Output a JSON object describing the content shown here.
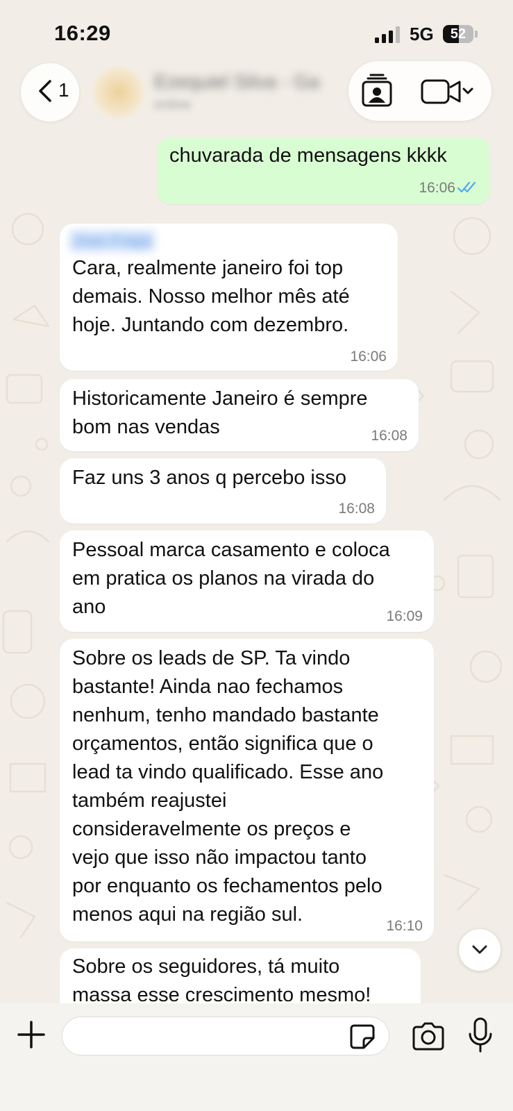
{
  "status_bar": {
    "time": "16:29",
    "network": "5G",
    "battery_percent": "52",
    "battery_level": 0.52
  },
  "header": {
    "back_count": "1",
    "contact_name": "Ezequiel Silva - Ga",
    "contact_subtitle": "online",
    "icons": [
      "chevron-left-icon",
      "contact-card-icon",
      "video-camera-icon",
      "chevron-down-icon"
    ]
  },
  "messages": [
    {
      "direction": "out",
      "text": [
        "chuvarada de mensagens kkkk"
      ],
      "time": "16:06",
      "status": "read"
    },
    {
      "direction": "in",
      "sender": "Joao Fraga",
      "text": [
        "Cara, realmente janeiro foi top",
        "demais. Nosso melhor mês até",
        "hoje. Juntando com dezembro."
      ],
      "time": "16:06"
    },
    {
      "direction": "in",
      "text": [
        "Historicamente Janeiro é sempre",
        "bom nas vendas"
      ],
      "time": "16:08"
    },
    {
      "direction": "in",
      "text": [
        "Faz uns 3 anos q percebo isso"
      ],
      "time": "16:08"
    },
    {
      "direction": "in",
      "text": [
        "Pessoal marca casamento e coloca",
        "em pratica os planos na virada do",
        "ano"
      ],
      "time": "16:09"
    },
    {
      "direction": "in",
      "text": [
        "Sobre os leads de SP. Ta vindo",
        "bastante! Ainda nao fechamos",
        "nenhum, tenho mandado bastante",
        "orçamentos, então significa que o",
        "lead ta vindo qualificado. Esse ano",
        "também reajustei",
        "consideravelmente os preços e",
        "vejo que isso não impactou tanto",
        "por enquanto os fechamentos pelo",
        "menos aqui na região sul."
      ],
      "time": "16:10"
    },
    {
      "direction": "in",
      "text": [
        "Sobre os seguidores, tá muito",
        "massa esse crescimento mesmo!"
      ],
      "time": ""
    }
  ],
  "composer": {
    "placeholder": "",
    "icons": [
      "plus-icon",
      "sticker-icon",
      "camera-icon",
      "microphone-icon"
    ]
  },
  "colors": {
    "outgoing_bubble": "#d9fdd3",
    "incoming_bubble": "#ffffff",
    "chat_background": "#f2eee7",
    "read_ticks": "#53a6f0"
  }
}
